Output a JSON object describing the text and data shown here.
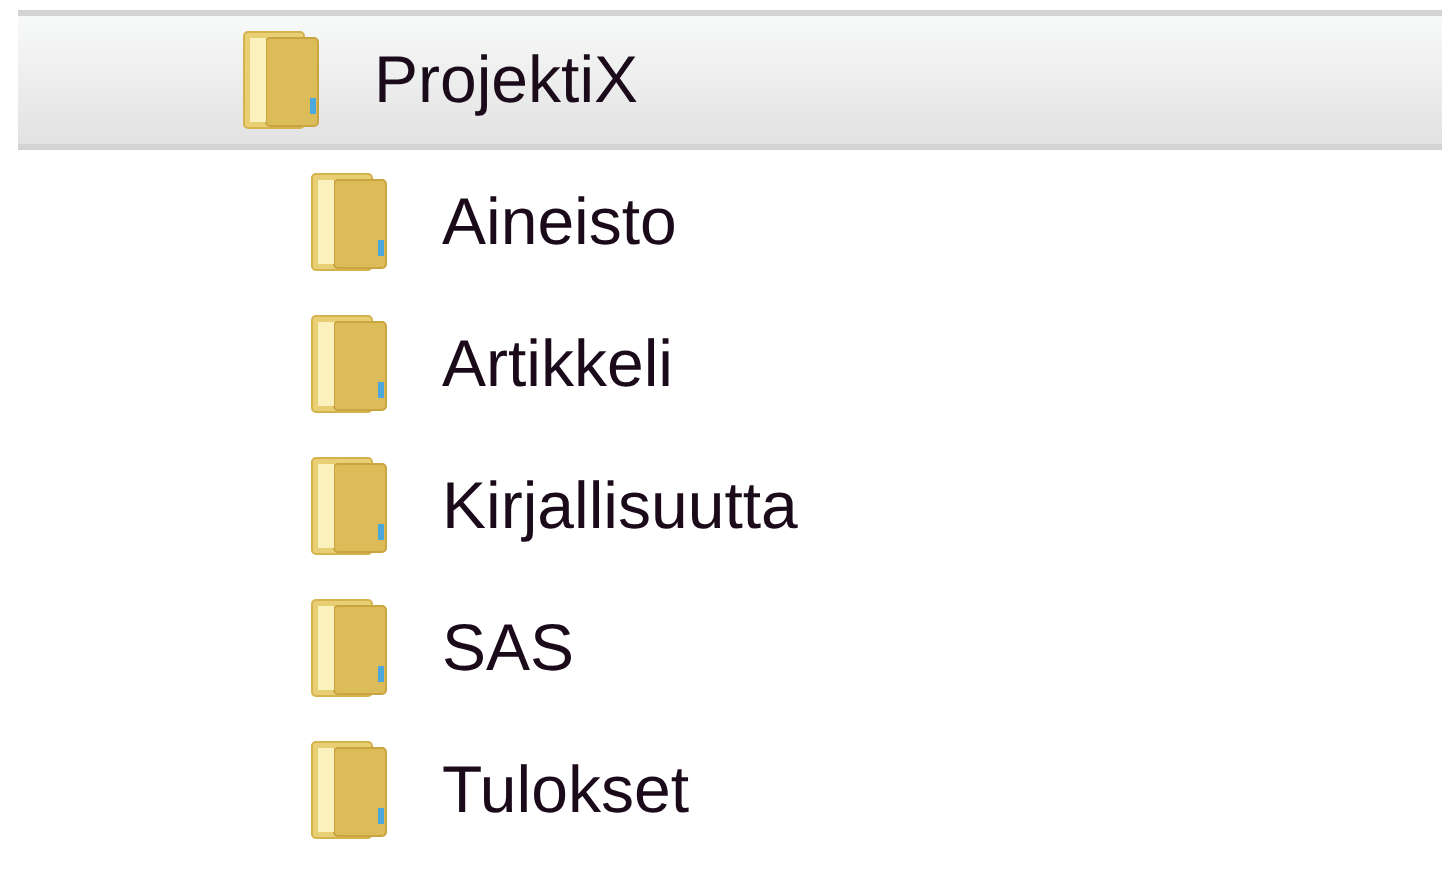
{
  "tree": [
    {
      "label": "ProjektiX",
      "selected": true,
      "children": [
        {
          "label": "Aineisto",
          "selected": false
        },
        {
          "label": "Artikkeli",
          "selected": false
        },
        {
          "label": "Kirjallisuutta",
          "selected": false
        },
        {
          "label": "SAS",
          "selected": false
        },
        {
          "label": "Tulokset",
          "selected": false
        }
      ]
    }
  ]
}
